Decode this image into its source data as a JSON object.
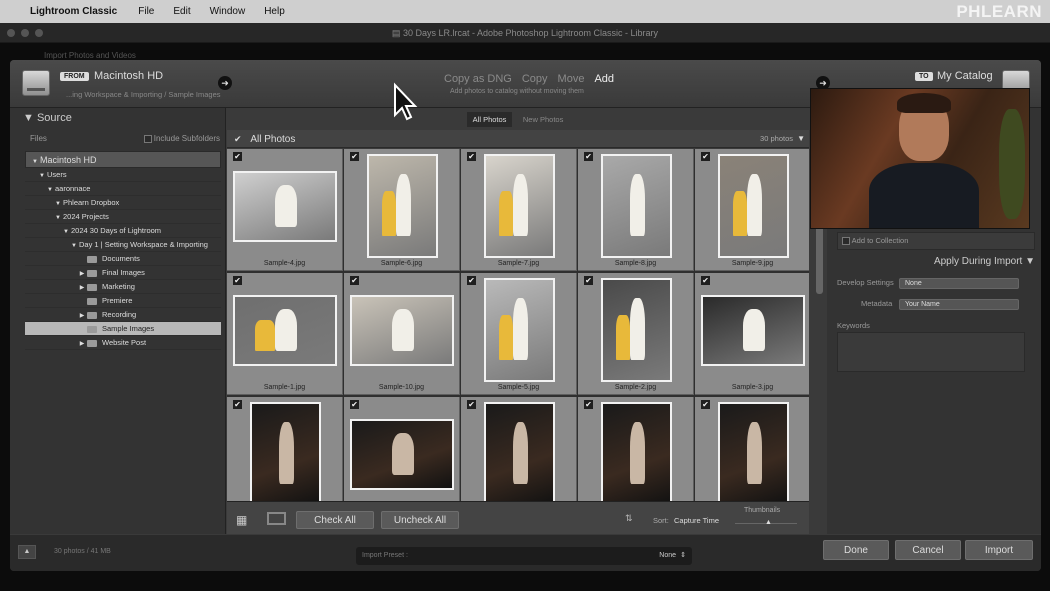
{
  "menubar": {
    "app": "Lightroom Classic",
    "items": [
      "File",
      "Edit",
      "Window",
      "Help"
    ],
    "brand": "PHLEARN"
  },
  "window": {
    "title": "30 Days LR.lrcat - Adobe Photoshop Lightroom Classic - Library",
    "behind_title": "Import Photos and Videos"
  },
  "import": {
    "from_label": "FROM",
    "source": "Macintosh HD",
    "source_path": "...ing Workspace & Importing / Sample Images",
    "modes": [
      "Copy as DNG",
      "Copy",
      "Move",
      "Add"
    ],
    "active_mode": "Add",
    "mode_desc": "Add photos to catalog without moving them",
    "to_label": "TO",
    "destination": "My Catalog"
  },
  "source_panel": {
    "title": "Source",
    "files_label": "Files",
    "include_subfolders": "Include Subfolders",
    "tree": [
      {
        "label": "Macintosh HD",
        "level": 0,
        "type": "header"
      },
      {
        "label": "Users",
        "level": 1
      },
      {
        "label": "aaronnace",
        "level": 2
      },
      {
        "label": "Phlearn Dropbox",
        "level": 3
      },
      {
        "label": "2024 Projects",
        "level": 3
      },
      {
        "label": "2024 30 Days of Lightroom",
        "level": 4
      },
      {
        "label": "Day 1 | Setting Workspace & Importing",
        "level": 5
      },
      {
        "label": "Documents",
        "level": 6,
        "folder": true
      },
      {
        "label": "Final Images",
        "level": 6,
        "folder": true,
        "expand": true
      },
      {
        "label": "Marketing",
        "level": 6,
        "folder": true,
        "expand": true
      },
      {
        "label": "Premiere",
        "level": 6,
        "folder": true
      },
      {
        "label": "Recording",
        "level": 6,
        "folder": true,
        "expand": true
      },
      {
        "label": "Sample Images",
        "level": 6,
        "folder": true,
        "selected": true
      },
      {
        "label": "Website Post",
        "level": 6,
        "folder": true,
        "expand": true
      }
    ]
  },
  "grid": {
    "tabs": [
      "All Photos",
      "New Photos"
    ],
    "active_tab": "All Photos",
    "header": "All Photos",
    "count": "30 photos",
    "photos": [
      {
        "name": "Sample-4.jpg",
        "orient": "land"
      },
      {
        "name": "Sample-6.jpg",
        "orient": "port"
      },
      {
        "name": "Sample-7.jpg",
        "orient": "port"
      },
      {
        "name": "Sample-8.jpg",
        "orient": "port"
      },
      {
        "name": "Sample-9.jpg",
        "orient": "port"
      },
      {
        "name": "Sample-1.jpg",
        "orient": "land"
      },
      {
        "name": "Sample-10.jpg",
        "orient": "land"
      },
      {
        "name": "Sample-5.jpg",
        "orient": "port"
      },
      {
        "name": "Sample-2.jpg",
        "orient": "port"
      },
      {
        "name": "Sample-3.jpg",
        "orient": "land"
      },
      {
        "name": "",
        "orient": "port"
      },
      {
        "name": "",
        "orient": "land"
      },
      {
        "name": "",
        "orient": "port"
      },
      {
        "name": "",
        "orient": "port"
      },
      {
        "name": "",
        "orient": "port"
      }
    ]
  },
  "toolbar": {
    "check_all": "Check All",
    "uncheck_all": "Uncheck All",
    "sort_label": "Sort:",
    "sort_value": "Capture Time",
    "thumbnails": "Thumbnails"
  },
  "right_panel": {
    "add_to_collection": "Add to Collection",
    "apply_title": "Apply During Import",
    "develop_label": "Develop Settings",
    "develop_value": "None",
    "metadata_label": "Metadata",
    "metadata_value": "Your Name",
    "keywords_label": "Keywords"
  },
  "bottom": {
    "status": "30 photos / 41 MB",
    "preset_label": "Import Preset :",
    "preset_value": "None",
    "done": "Done",
    "cancel": "Cancel",
    "import": "Import"
  }
}
